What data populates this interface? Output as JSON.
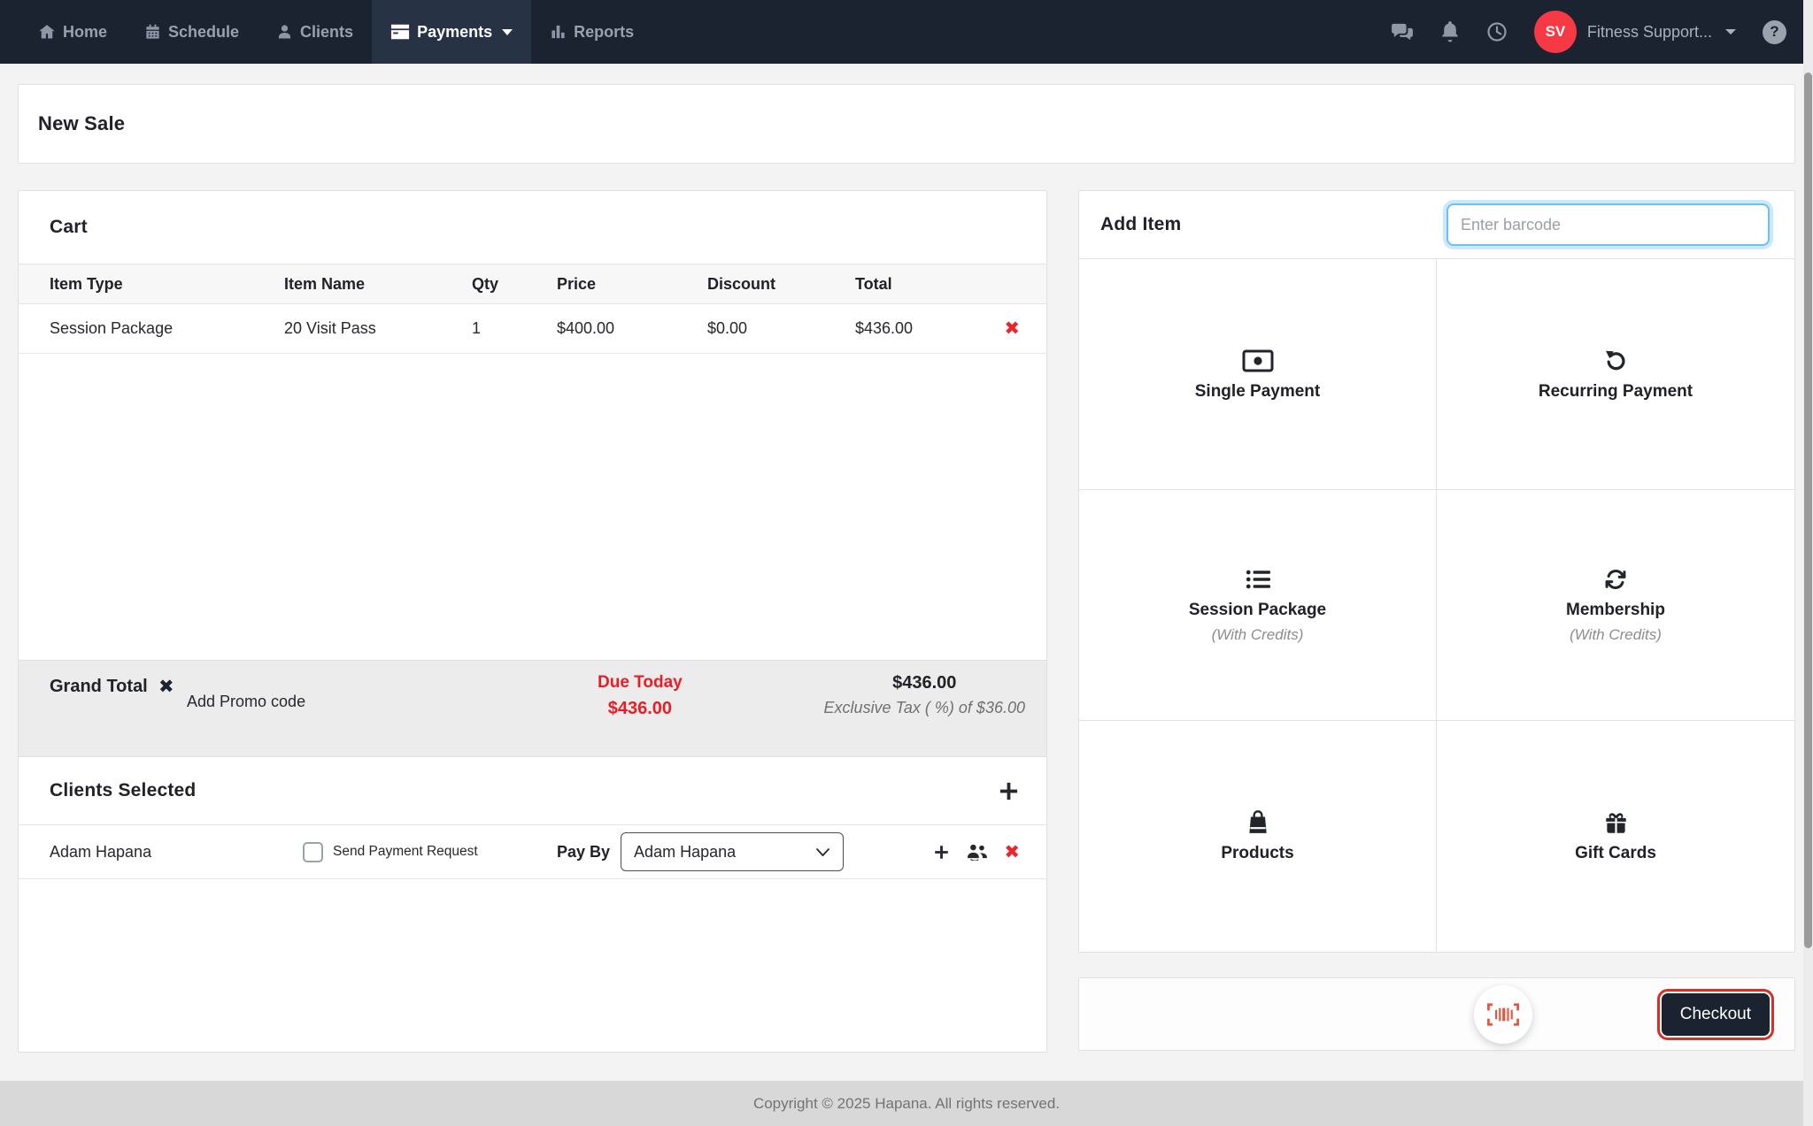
{
  "navbar": {
    "items": [
      {
        "label": "Home",
        "icon": "home-icon",
        "active": false
      },
      {
        "label": "Schedule",
        "icon": "calendar-icon",
        "active": false
      },
      {
        "label": "Clients",
        "icon": "clients-icon",
        "active": false
      },
      {
        "label": "Payments",
        "icon": "credit-card-icon",
        "active": true,
        "has_dropdown": true
      },
      {
        "label": "Reports",
        "icon": "bar-chart-icon",
        "active": false
      }
    ],
    "right": {
      "icons": [
        "messages-icon",
        "notifications-icon",
        "history-icon",
        "help-icon"
      ],
      "avatar_initials": "SV",
      "account_label": "Fitness Support..."
    }
  },
  "page": {
    "title": "New Sale"
  },
  "cart": {
    "title": "Cart",
    "columns": {
      "item_type": "Item Type",
      "item_name": "Item Name",
      "qty": "Qty",
      "price": "Price",
      "discount": "Discount",
      "total": "Total"
    },
    "rows": [
      {
        "item_type": "Session Package",
        "item_name": "20 Visit Pass",
        "qty": "1",
        "price": "$400.00",
        "discount": "$0.00",
        "total": "$436.00"
      }
    ],
    "summary": {
      "grand_total_label": "Grand Total",
      "add_promo_label": "Add Promo code",
      "due_today_label": "Due Today",
      "due_today_amount": "$436.00",
      "total_amount": "$436.00",
      "tax_note": "Exclusive Tax ( %) of $36.00"
    }
  },
  "clients": {
    "title": "Clients Selected",
    "rows": [
      {
        "name": "Adam Hapana",
        "send_payment_request_label": "Send Payment Request",
        "send_payment_request_checked": false,
        "pay_by_label": "Pay By",
        "pay_by_value": "Adam Hapana"
      }
    ]
  },
  "add_item": {
    "title": "Add Item",
    "barcode_placeholder": "Enter barcode",
    "tiles": [
      {
        "label": "Single Payment",
        "icon": "money-bill-icon"
      },
      {
        "label": "Recurring Payment",
        "icon": "rotate-left-icon"
      },
      {
        "label": "Session Package",
        "subtitle": "(With Credits)",
        "icon": "list-icon"
      },
      {
        "label": "Membership",
        "subtitle": "(With Credits)",
        "icon": "sync-icon"
      },
      {
        "label": "Products",
        "icon": "shopping-bag-icon"
      },
      {
        "label": "Gift Cards",
        "icon": "gift-icon"
      }
    ]
  },
  "actions": {
    "checkout_label": "Checkout",
    "scan_icon": "barcode-scan-icon"
  },
  "footer": {
    "copyright": "Copyright © 2025 Hapana. All rights reserved."
  },
  "icons": {
    "remove_glyph": "✖",
    "help_glyph": "?"
  },
  "colors": {
    "navbar_bg": "#1b2230",
    "navbar_active_bg": "#273245",
    "avatar_red": "#f73845",
    "danger_red": "#e8262d",
    "due_red": "#ed1c24",
    "checkout_ring_red": "#d93025",
    "scan_orange": "#e8533a",
    "focus_blue": "#53b7f0",
    "grand_total_bg": "#ececec",
    "footer_bg": "#d8d8d8"
  }
}
